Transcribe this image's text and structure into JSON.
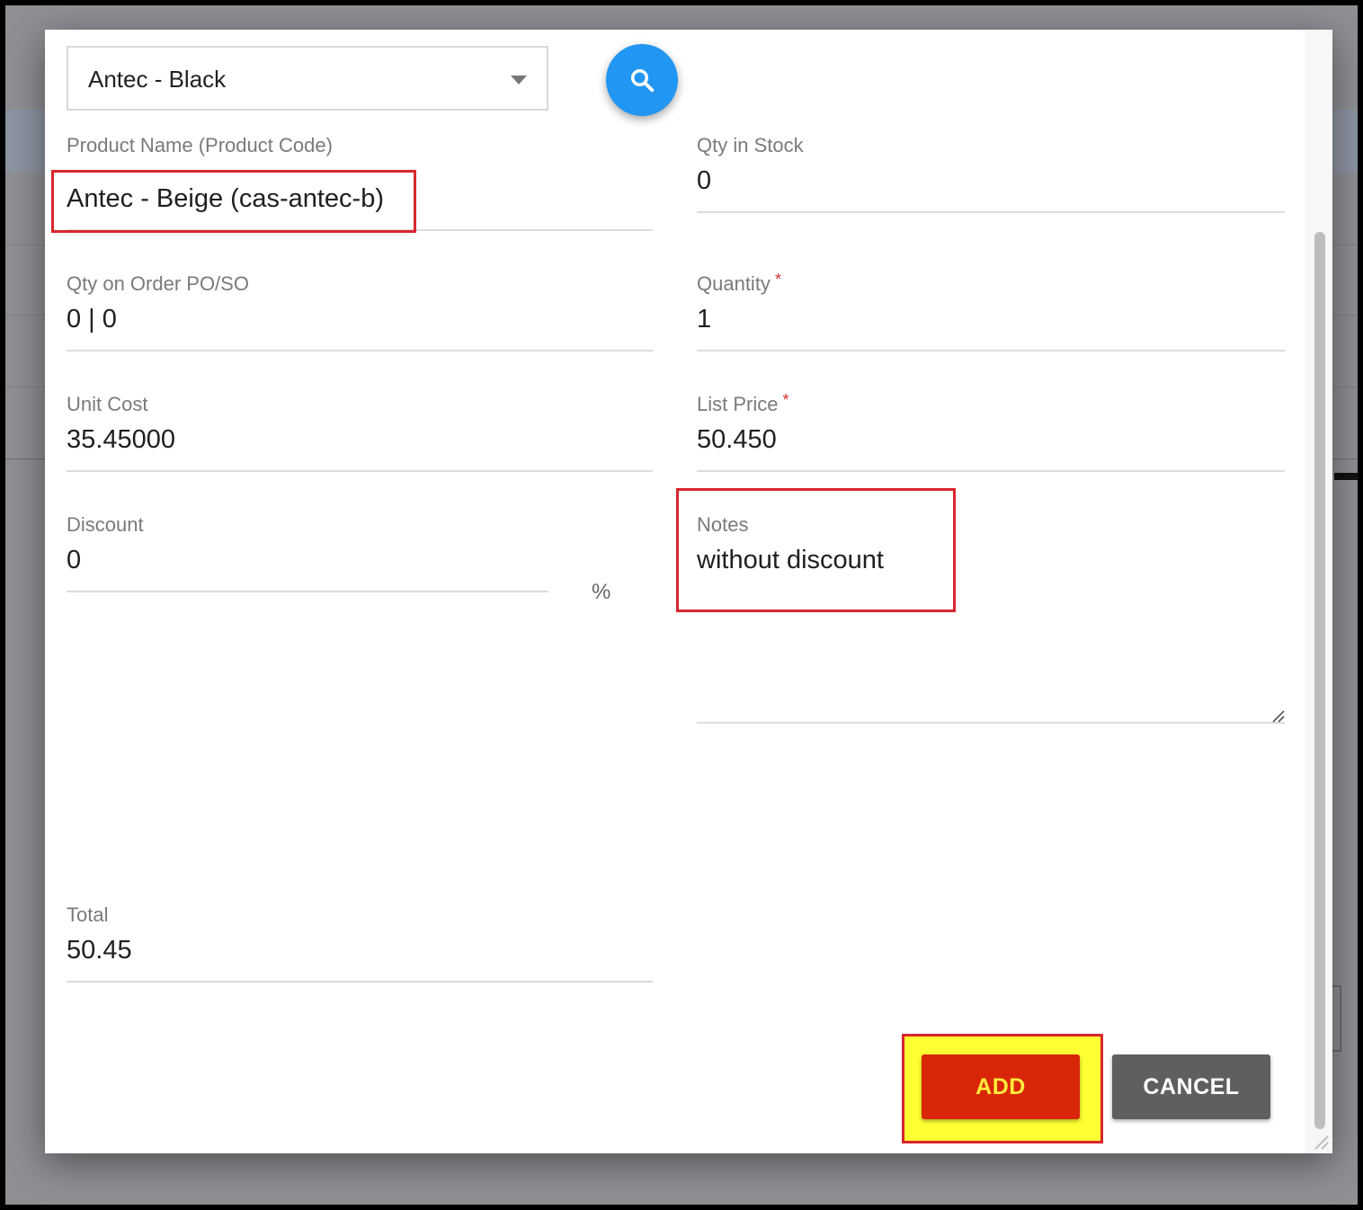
{
  "product_select": {
    "selected": "Antec - Black"
  },
  "search_button": {
    "icon": "search-icon"
  },
  "fields": {
    "product_name": {
      "label": "Product Name (Product Code)",
      "value": "Antec - Beige (cas-antec-b)"
    },
    "qty_in_stock": {
      "label": "Qty in Stock",
      "value": "0"
    },
    "qty_on_order": {
      "label": "Qty on Order PO/SO",
      "value": "0 | 0"
    },
    "quantity": {
      "label": "Quantity",
      "required_mark": "*",
      "value": "1"
    },
    "unit_cost": {
      "label": "Unit Cost",
      "value": "35.45000"
    },
    "list_price": {
      "label": "List Price",
      "required_mark": "*",
      "value": "50.450"
    },
    "discount": {
      "label": "Discount",
      "value": "0",
      "unit": "%"
    },
    "notes": {
      "label": "Notes",
      "value": "without discount"
    },
    "total": {
      "label": "Total",
      "value": "50.45"
    }
  },
  "buttons": {
    "add_label": "ADD",
    "cancel_label": "CANCEL"
  },
  "colors": {
    "add_button": "#d92608",
    "add_button_text": "#ffeb3b",
    "cancel_button": "#5f5f5f",
    "fab": "#2196f3",
    "highlight_border": "#d9262e",
    "highlight_fill": "#ffff33",
    "required": "#d32f2f"
  }
}
